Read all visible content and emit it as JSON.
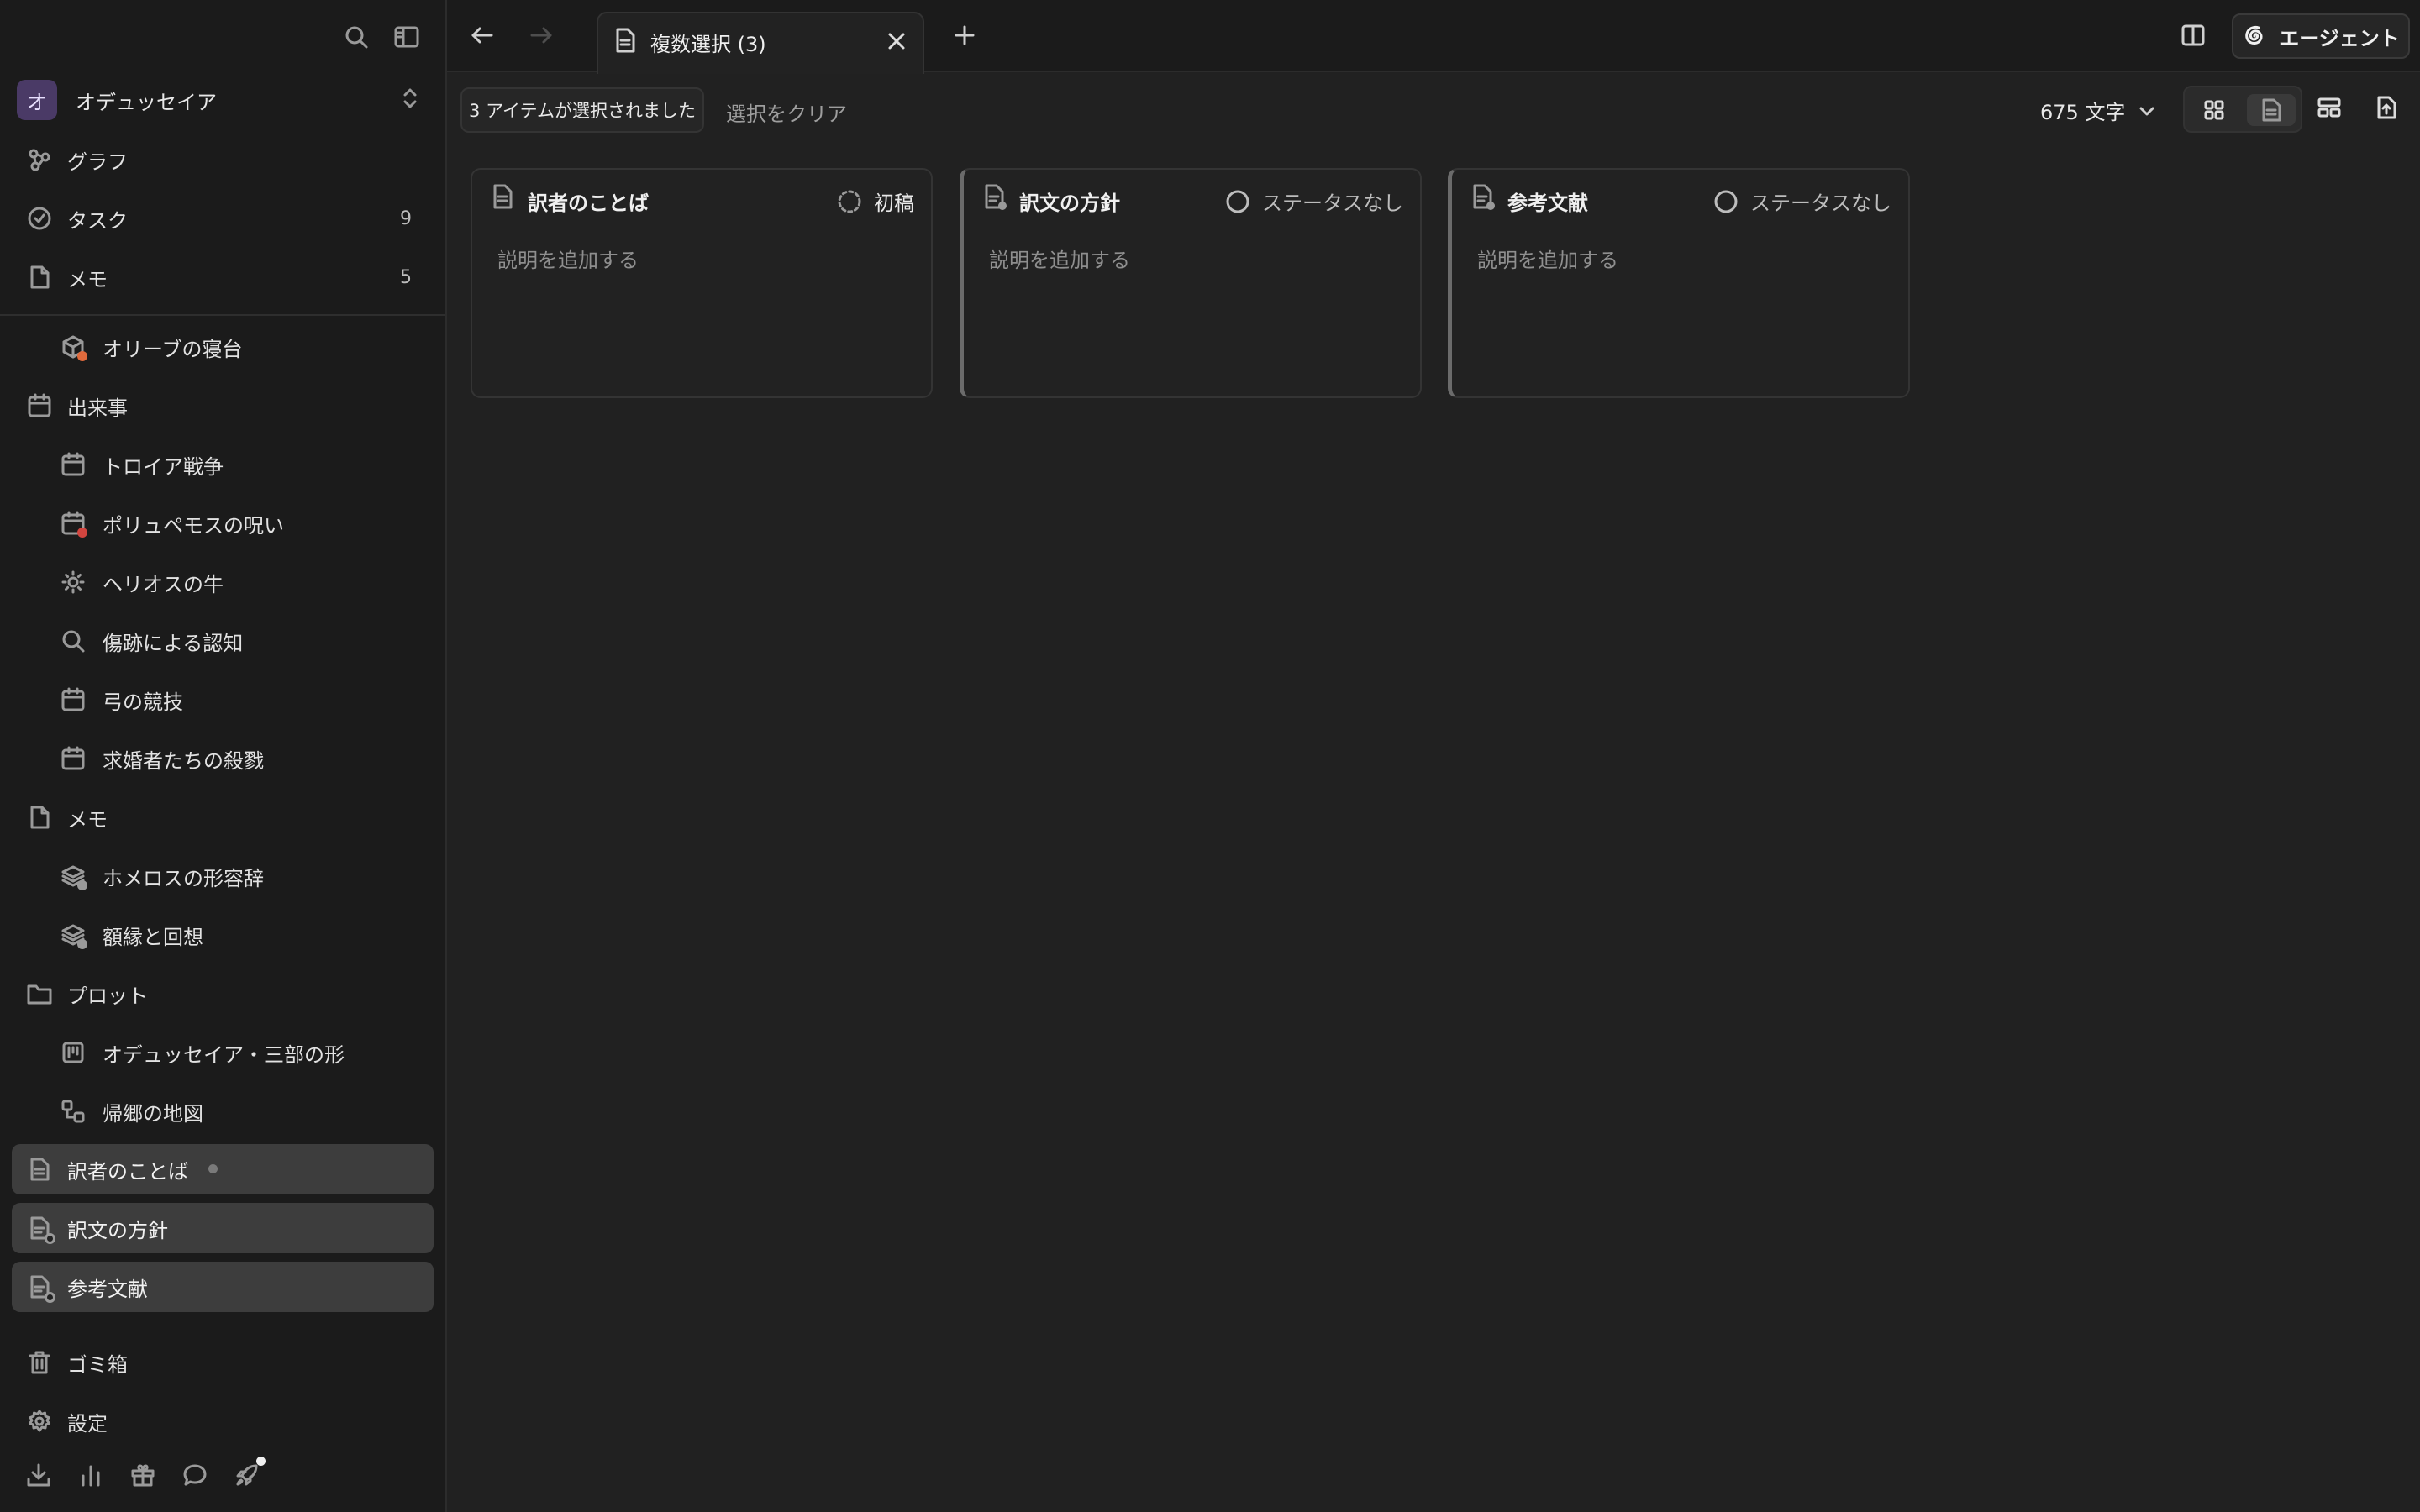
{
  "workspace": {
    "initial": "オ",
    "name": "オデュッセイア"
  },
  "nav": {
    "graph": "グラフ",
    "tasks": {
      "label": "タスク",
      "count": "9"
    },
    "memos": {
      "label": "メモ",
      "count": "5"
    }
  },
  "tree": {
    "olive_bed": "オリーブの寝台",
    "events": "出来事",
    "trojan_war": "トロイア戦争",
    "polyphemus": "ポリュペモスの呪い",
    "helios": "ヘリオスの牛",
    "scar": "傷跡による認知",
    "bow": "弓の競技",
    "suitors": "求婚者たちの殺戮",
    "memo_folder": "メモ",
    "epithets": "ホメロスの形容辞",
    "framing": "額縁と回想",
    "plot": "プロット",
    "three_part": "オデュッセイア・三部の形",
    "homecoming_map": "帰郷の地図",
    "translator_note": "訳者のことば",
    "translation_policy": "訳文の方針",
    "references": "参考文献"
  },
  "footer": {
    "trash": "ゴミ箱",
    "settings": "設定"
  },
  "tab": {
    "title": "複数選択 (3)"
  },
  "agent": {
    "label": "エージェント"
  },
  "toolbar": {
    "selected": "3 アイテムが選択されました",
    "clear": "選択をクリア",
    "word_count": "675 文字"
  },
  "cards": [
    {
      "title": "訳者のことば",
      "status": "初稿",
      "desc": "説明を追加する"
    },
    {
      "title": "訳文の方針",
      "status": "ステータスなし",
      "desc": "説明を追加する"
    },
    {
      "title": "参考文献",
      "status": "ステータスなし",
      "desc": "説明を追加する"
    }
  ]
}
